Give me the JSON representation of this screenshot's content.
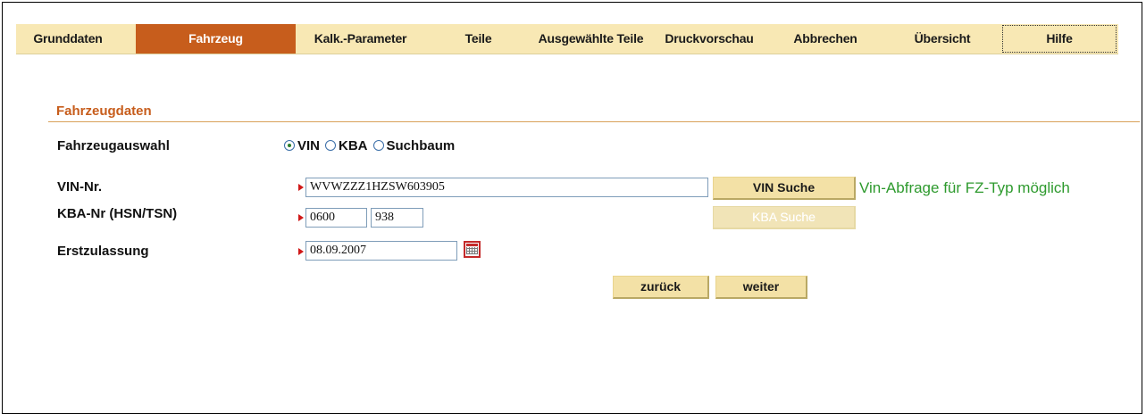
{
  "tabs": [
    {
      "label": "Grunddaten"
    },
    {
      "label": "Fahrzeug"
    },
    {
      "label": "Kalk.-Parameter"
    },
    {
      "label": "Teile"
    },
    {
      "label": "Ausgewählte Teile"
    },
    {
      "label": "Druckvorschau"
    },
    {
      "label": "Abbrechen"
    },
    {
      "label": "Übersicht"
    },
    {
      "label": "Hilfe"
    }
  ],
  "active_tab": "Fahrzeug",
  "section": {
    "title": "Fahrzeugdaten"
  },
  "form": {
    "vehicle_selection": {
      "label": "Fahrzeugauswahl",
      "options": [
        "VIN",
        "KBA",
        "Suchbaum"
      ],
      "selected": "VIN"
    },
    "vin": {
      "label": "VIN-Nr.",
      "value": "WVWZZZ1HZSW603905",
      "search_button": "VIN Suche",
      "hint": "Vin-Abfrage für FZ-Typ möglich"
    },
    "kba": {
      "label": "KBA-Nr (HSN/TSN)",
      "hsn": "0600",
      "tsn": "938",
      "search_button": "KBA Suche"
    },
    "first_registration": {
      "label": "Erstzulassung",
      "value": "08.09.2007"
    }
  },
  "nav": {
    "back": "zurück",
    "next": "weiter"
  },
  "colors": {
    "accent": "#c75d1c",
    "tab_bg": "#f8e8b4",
    "hint_green": "#2e9a2e",
    "required_red": "#d01818"
  }
}
